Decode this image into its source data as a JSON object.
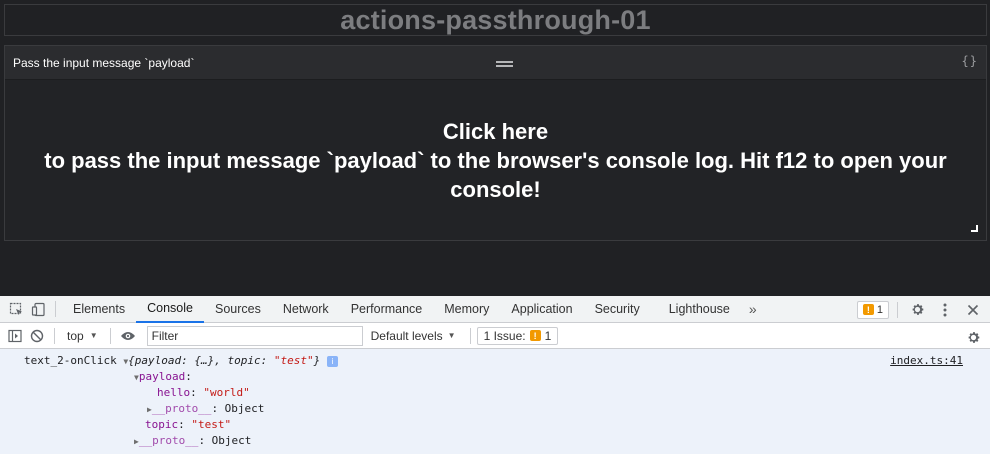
{
  "dashboard": {
    "title": "actions-passthrough-01",
    "panel": {
      "title": "Pass the input message `payload`",
      "braces_icon": "{}",
      "body_line1": "Click here",
      "body_line2": "to pass the input message `payload` to the browser's console log. Hit f12 to open your console!"
    }
  },
  "devtools": {
    "tabs": [
      "Elements",
      "Console",
      "Sources",
      "Network",
      "Performance",
      "Memory",
      "Application",
      "Security",
      "Lighthouse"
    ],
    "active_tab": "Console",
    "more_tabs": "»",
    "issues_count": "1",
    "toolbar": {
      "context": "top",
      "filter_placeholder": "Filter",
      "levels": "Default levels",
      "issue_label": "1 Issue:",
      "issue_count": "1"
    },
    "console": {
      "source": "index.ts:41",
      "line1_label": "text_2-onClick",
      "line1_open": "{",
      "line1_key1": "payload",
      "line1_mid": ": {…}, ",
      "line1_key2": "topic",
      "line1_colon": ": ",
      "line1_val2": "\"test\"",
      "line1_close": "}",
      "info_badge": "i",
      "payload_key": "payload",
      "hello_key": "hello",
      "hello_val": "\"world\"",
      "proto_key": "__proto__",
      "proto_val": ": Object",
      "topic_key": "topic",
      "topic_val": "\"test\"",
      "proto2_key": "__proto__",
      "proto2_val": ": Object"
    }
  },
  "colors": {
    "page_bg": "#202124",
    "active_tab_underline": "#1a73e8",
    "warning": "#f29900",
    "console_key": "#881391",
    "console_string": "#c41a16"
  }
}
